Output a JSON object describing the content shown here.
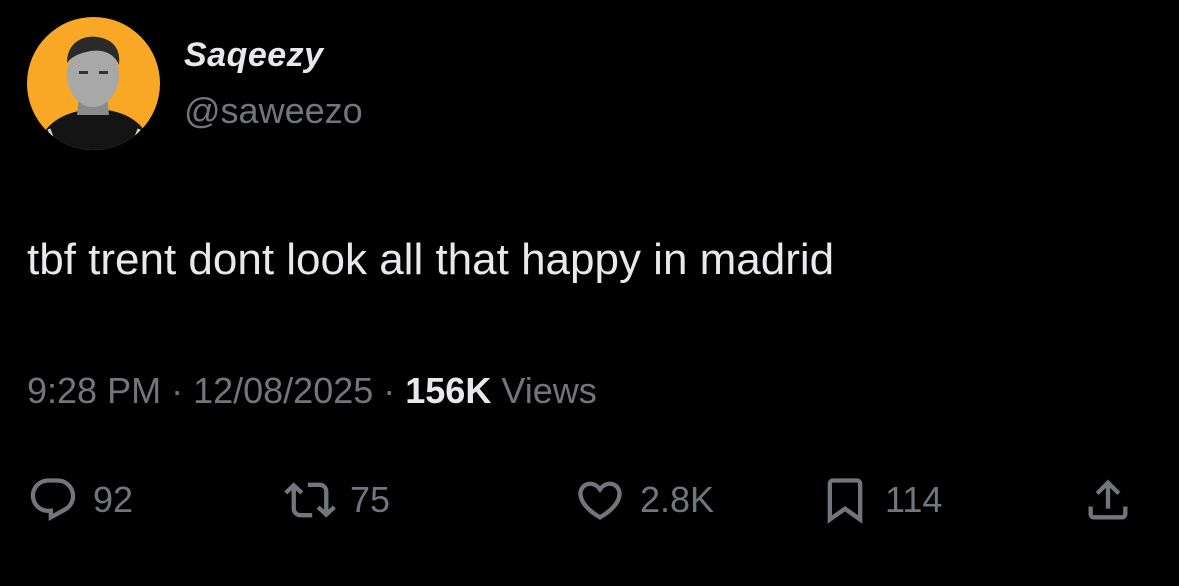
{
  "author": {
    "display_name": "Saqeezy",
    "handle": "@saweezo",
    "avatar_bg": "#f9a825"
  },
  "tweet": {
    "text": "tbf trent dont look all that happy in madrid",
    "time": "9:28 PM",
    "sep1": " · ",
    "date": "12/08/2025",
    "sep2": " · ",
    "views_count": "156K",
    "views_label": " Views"
  },
  "actions": {
    "replies": "92",
    "reposts": "75",
    "likes": "2.8K",
    "bookmarks": "114"
  },
  "colors": {
    "background": "#000000",
    "primary_text": "#e7e9ea",
    "secondary_text": "#71767b"
  },
  "icons": [
    "reply-icon",
    "repost-icon",
    "like-icon",
    "bookmark-icon",
    "share-icon"
  ]
}
